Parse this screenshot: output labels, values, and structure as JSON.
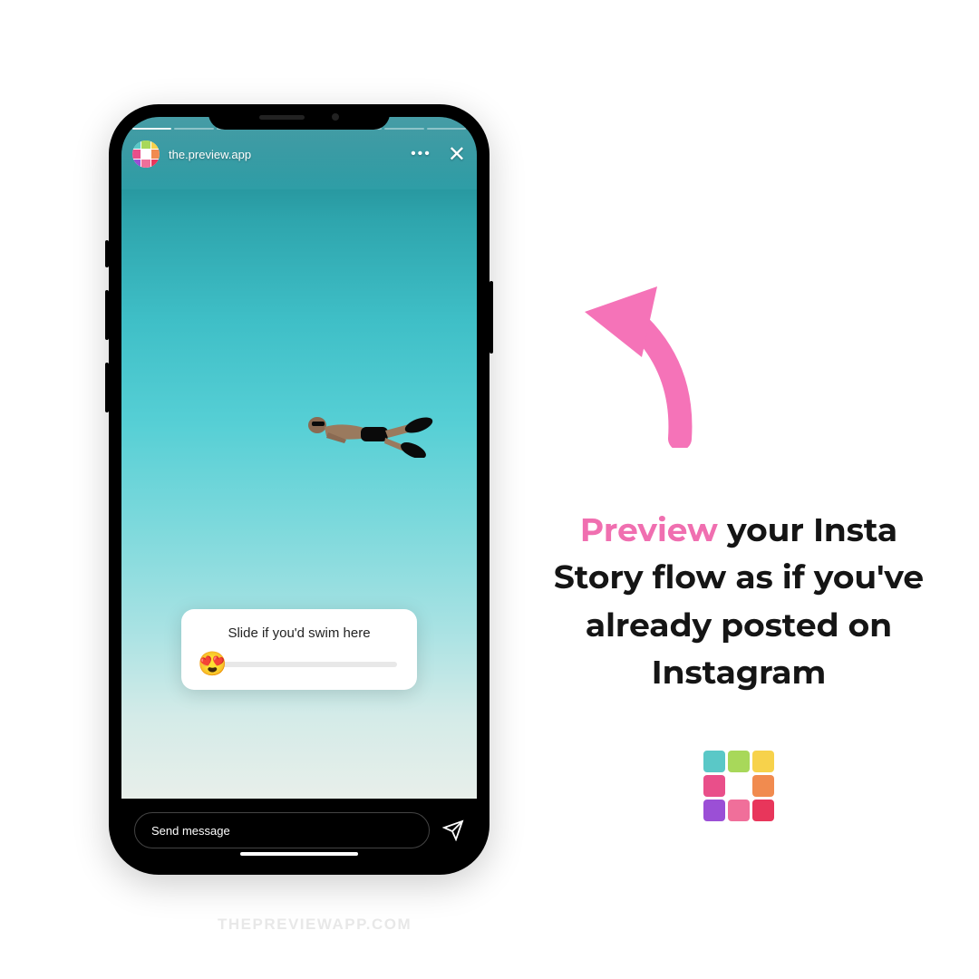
{
  "story": {
    "username": "the.preview.app",
    "progress_segments": 8,
    "active_segment": 0,
    "slider_prompt": "Slide if you'd swim here",
    "slider_emoji": "😍",
    "message_placeholder": "Send message"
  },
  "caption": {
    "highlighted": "Preview",
    "rest": "your Insta Story flow as if you've already posted on Instagram"
  },
  "colors": {
    "accent_pink": "#f06fb0",
    "arrow_pink": "#f573b8",
    "logo": {
      "c1": "#5ac8c7",
      "c2": "#a8d85a",
      "c3": "#f7d24b",
      "c4": "#e94f8a",
      "c5": "#ffffff",
      "c6": "#f18b4f",
      "c7": "#9b4fd6",
      "c8": "#f06f9a",
      "c9": "#e8365b"
    }
  },
  "watermark": "THEPREVIEWAPP.COM"
}
